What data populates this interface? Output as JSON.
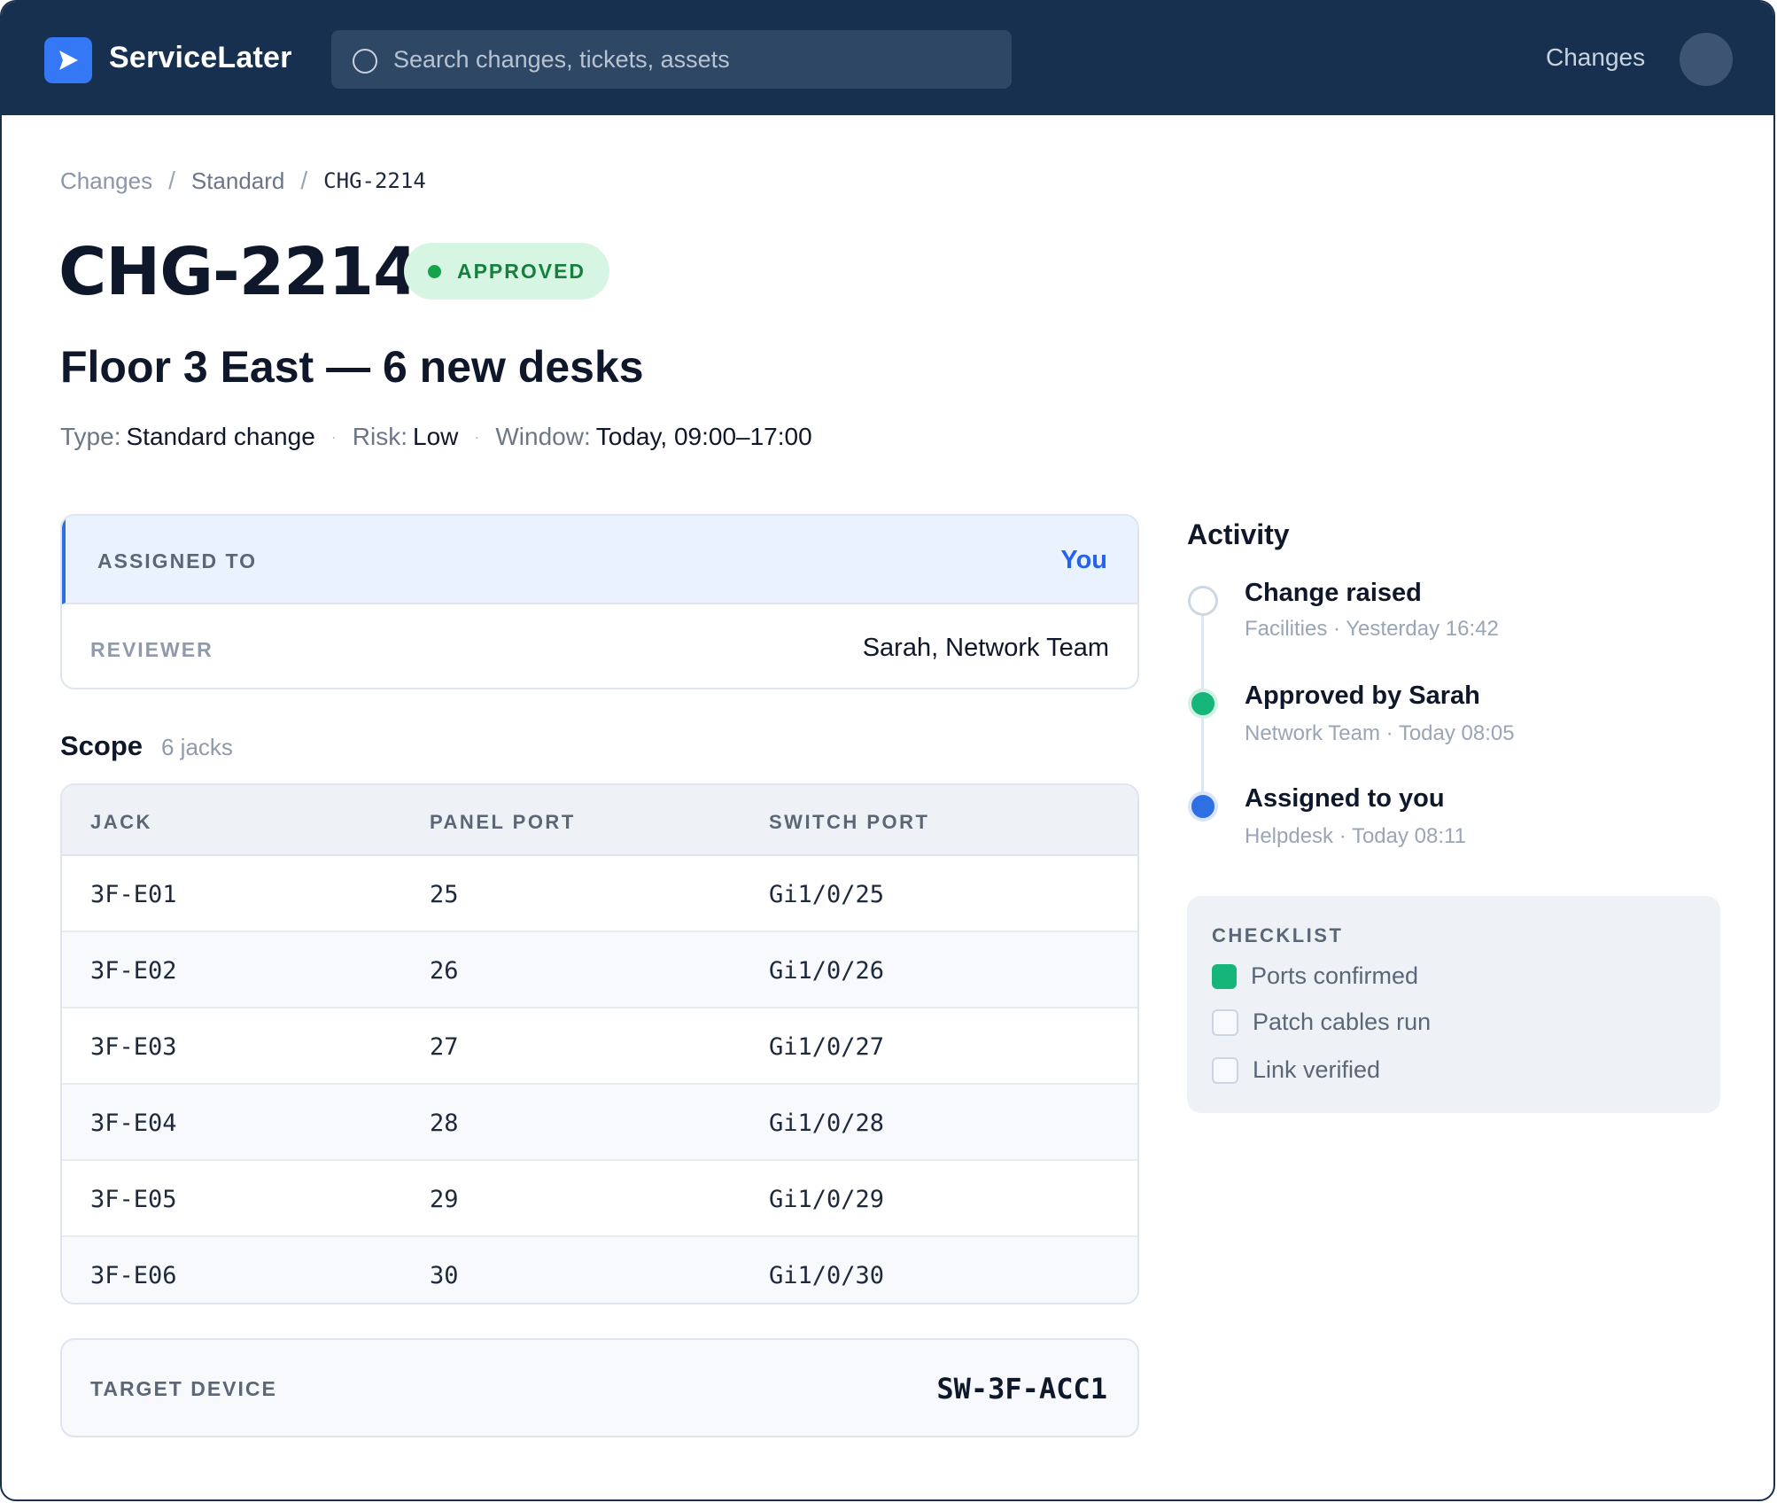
{
  "app": {
    "brand": "ServiceLater",
    "search_placeholder": "Search changes, tickets, assets",
    "nav_changes": "Changes"
  },
  "breadcrumb": {
    "items": [
      "Changes",
      "Standard"
    ],
    "separator": "/",
    "current": "CHG-2214"
  },
  "change": {
    "id": "CHG-2214",
    "status": "APPROVED",
    "title": "Floor 3 East — 6 new desks",
    "meta": {
      "type_label": "Type:",
      "type_value": "Standard change",
      "risk_label": "Risk:",
      "risk_value": "Low",
      "window_label": "Window:",
      "window_value": "Today, 09:00–17:00"
    }
  },
  "assignment": {
    "assigned_label": "ASSIGNED TO",
    "assigned_value": "You",
    "reviewer_label": "REVIEWER",
    "reviewer_value": "Sarah, Network Team"
  },
  "scope": {
    "title": "Scope",
    "count": "6 jacks",
    "columns": [
      "JACK",
      "PANEL PORT",
      "SWITCH PORT"
    ],
    "rows": [
      [
        "3F-E01",
        "25",
        "Gi1/0/25"
      ],
      [
        "3F-E02",
        "26",
        "Gi1/0/26"
      ],
      [
        "3F-E03",
        "27",
        "Gi1/0/27"
      ],
      [
        "3F-E04",
        "28",
        "Gi1/0/28"
      ],
      [
        "3F-E05",
        "29",
        "Gi1/0/29"
      ],
      [
        "3F-E06",
        "30",
        "Gi1/0/30"
      ]
    ]
  },
  "target_device": {
    "label": "TARGET DEVICE",
    "value": "SW-3F-ACC1"
  },
  "activity": {
    "title": "Activity",
    "events": [
      {
        "title": "Change raised",
        "subtitle": "Facilities · Yesterday 16:42",
        "state": "pending"
      },
      {
        "title": "Approved by Sarah",
        "subtitle": "Network Team · Today 08:05",
        "state": "done"
      },
      {
        "title": "Assigned to you",
        "subtitle": "Helpdesk · Today 08:11",
        "state": "current"
      }
    ]
  },
  "checklist": {
    "title": "CHECKLIST",
    "items": [
      {
        "label": "Ports confirmed",
        "checked": true
      },
      {
        "label": "Patch cables run",
        "checked": false
      },
      {
        "label": "Link verified",
        "checked": false
      }
    ]
  },
  "colors": {
    "topbar": "#17304f",
    "accent": "#2f6fe4",
    "approved_bg": "#d6f5e3",
    "approved_text": "#15803d",
    "done_green": "#16b57a"
  }
}
